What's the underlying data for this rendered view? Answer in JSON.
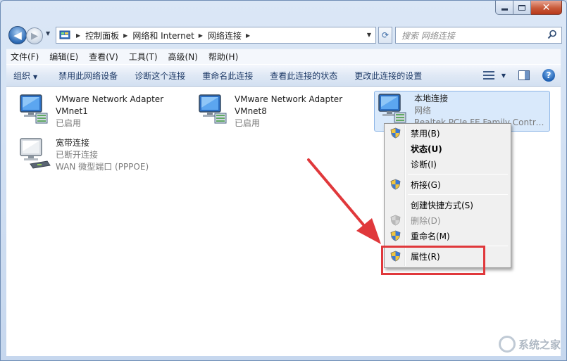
{
  "window": {
    "caption": {
      "minimize": "",
      "maximize": "",
      "close": "✕"
    }
  },
  "nav": {
    "back_glyph": "◀",
    "forward_glyph": "▶",
    "breadcrumbs": [
      "控制面板",
      "网络和 Internet",
      "网络连接"
    ],
    "refresh_glyph": "⟳",
    "search_placeholder": "搜索 网络连接"
  },
  "menubar": {
    "items": [
      "文件(F)",
      "编辑(E)",
      "查看(V)",
      "工具(T)",
      "高级(N)",
      "帮助(H)"
    ]
  },
  "commandbar": {
    "organize": "组织",
    "commands": [
      "禁用此网络设备",
      "诊断这个连接",
      "重命名此连接",
      "查看此连接的状态",
      "更改此连接的设置"
    ],
    "help": "?"
  },
  "connections": [
    {
      "name": "VMware Network Adapter VMnet1",
      "status": "已启用",
      "device": ""
    },
    {
      "name": "VMware Network Adapter VMnet8",
      "status": "已启用",
      "device": ""
    },
    {
      "name": "本地连接",
      "status": "网络",
      "device": "Realtek PCIe FE Family Controller"
    },
    {
      "name": "宽带连接",
      "status": "已断开连接",
      "device": "WAN 微型端口 (PPPOE)"
    }
  ],
  "context_menu": {
    "items": [
      {
        "label": "禁用(B)",
        "shield": true
      },
      {
        "label": "状态(U)",
        "bold": true
      },
      {
        "label": "诊断(I)"
      },
      {
        "label": "桥接(G)",
        "shield": true
      },
      {
        "label": "创建快捷方式(S)"
      },
      {
        "label": "删除(D)",
        "shield": true,
        "disabled": true
      },
      {
        "label": "重命名(M)",
        "shield": true
      },
      {
        "label": "属性(R)",
        "shield": true
      }
    ]
  },
  "annotations": {
    "highlight_color": "#e0383b",
    "arrow_color": "#e0383b"
  },
  "watermark": {
    "brand": "系统之家"
  },
  "colors": {
    "selection": "#d9e9fb",
    "command_text": "#1e3a67",
    "accent": "#2c6ab5"
  }
}
